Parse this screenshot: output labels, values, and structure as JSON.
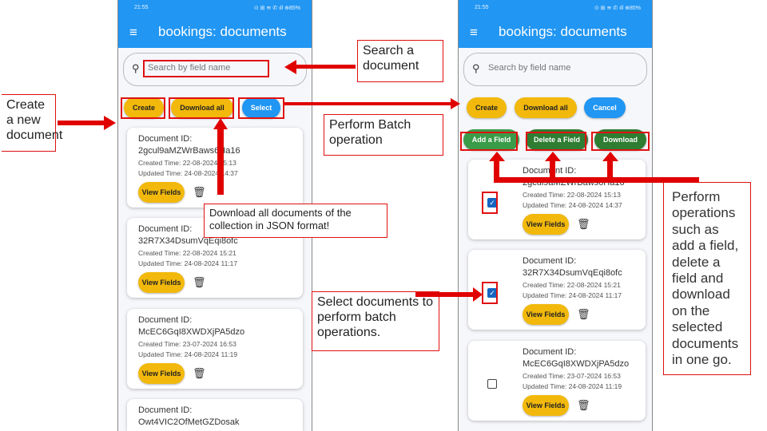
{
  "status": {
    "time": "21:55",
    "icons": "⊙ ⊞ ≋ ✆ ıll ⊕85%"
  },
  "app": {
    "title": "bookings: documents",
    "search_placeholder": "Search by field name"
  },
  "left": {
    "buttons": {
      "create": "Create",
      "download_all": "Download all",
      "select": "Select"
    }
  },
  "right": {
    "buttons": {
      "create": "Create",
      "download_all": "Download all",
      "cancel": "Cancel",
      "add_field": "Add a Field",
      "delete_field": "Delete a Field",
      "download": "Download"
    }
  },
  "labels": {
    "doc_id": "Document ID:",
    "view_fields": "View Fields"
  },
  "documents": [
    {
      "id": "2gcul9aMZWrBaws6Ha16",
      "created": "Created Time: 22-08-2024 15:13",
      "updated": "Updated Time: 24-08-2024 14:37",
      "selected": true
    },
    {
      "id": "32R7X34DsumVqEqi8ofc",
      "created": "Created Time: 22-08-2024 15:21",
      "updated": "Updated Time: 24-08-2024 11:17",
      "selected": true
    },
    {
      "id": "McEC6GqI8XWDXjPA5dzo",
      "created": "Created Time: 23-07-2024 16:53",
      "updated": "Updated Time: 24-08-2024 11:19",
      "selected": false
    },
    {
      "id": "Owt4VIC2OfMetGZDosak"
    }
  ],
  "annotations": {
    "search": "Search a document",
    "create": "Create a new document",
    "batch": "Perform Batch operation",
    "download_all": "Download all documents of the collection in JSON format!",
    "select": "Select documents to perform batch operations.",
    "operations": "Perform operations such as add a field, delete a field and download on the selected documents in one go."
  },
  "colors": {
    "appbar": "#2196f3",
    "yellow_button": "#f2b90c",
    "green_button": "#3a9b48",
    "annotation": "#e01010"
  }
}
